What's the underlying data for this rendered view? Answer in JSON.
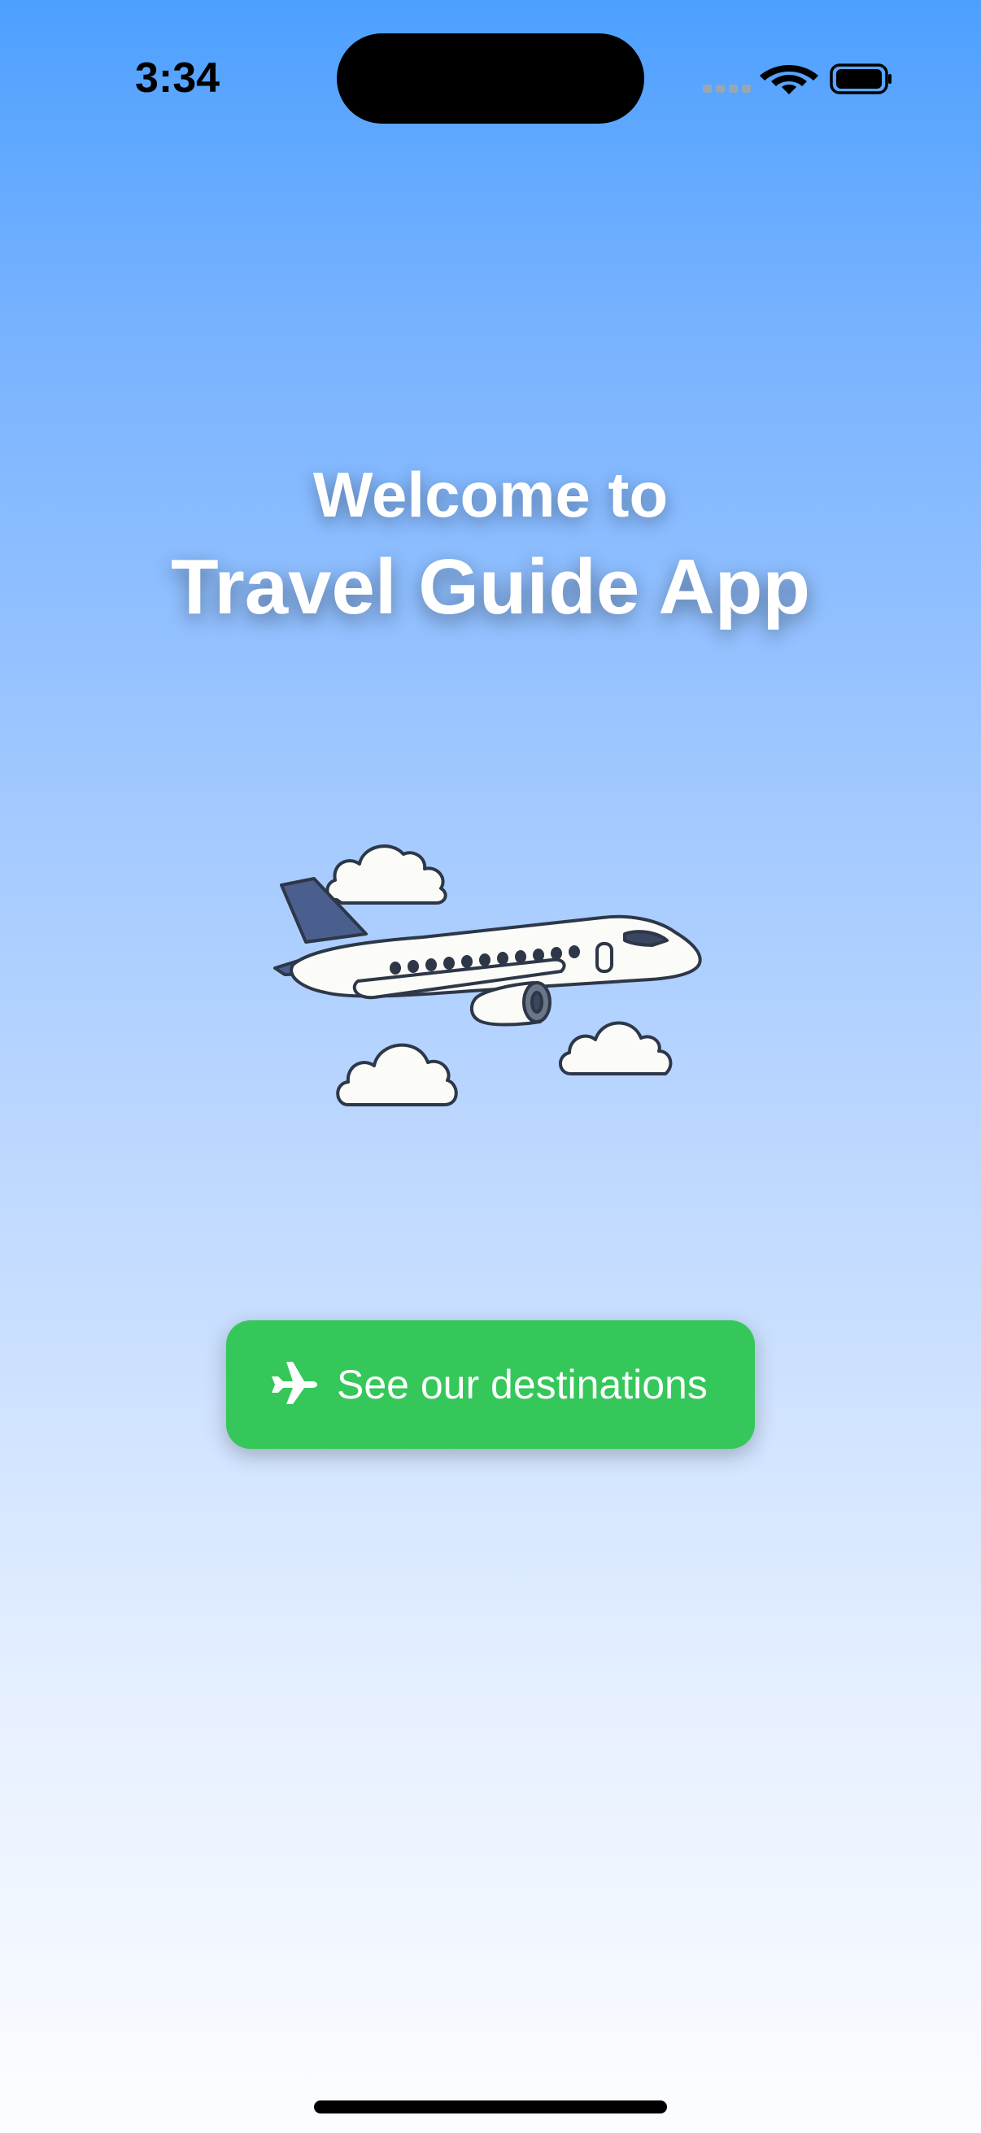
{
  "status_bar": {
    "time": "3:34",
    "icons": [
      "cellular-signal-icon",
      "wifi-icon",
      "battery-icon"
    ]
  },
  "header": {
    "welcome": "Welcome to",
    "title": "Travel Guide App"
  },
  "illustration": {
    "icon": "airplane-with-clouds-illustration"
  },
  "cta": {
    "label": "See our destinations",
    "icon": "airplane-icon",
    "color": "#35C75A"
  },
  "colors": {
    "gradient_top": "#4DA0FF",
    "gradient_bottom": "#FCFDFF",
    "title_text": "#FFFFFF"
  }
}
